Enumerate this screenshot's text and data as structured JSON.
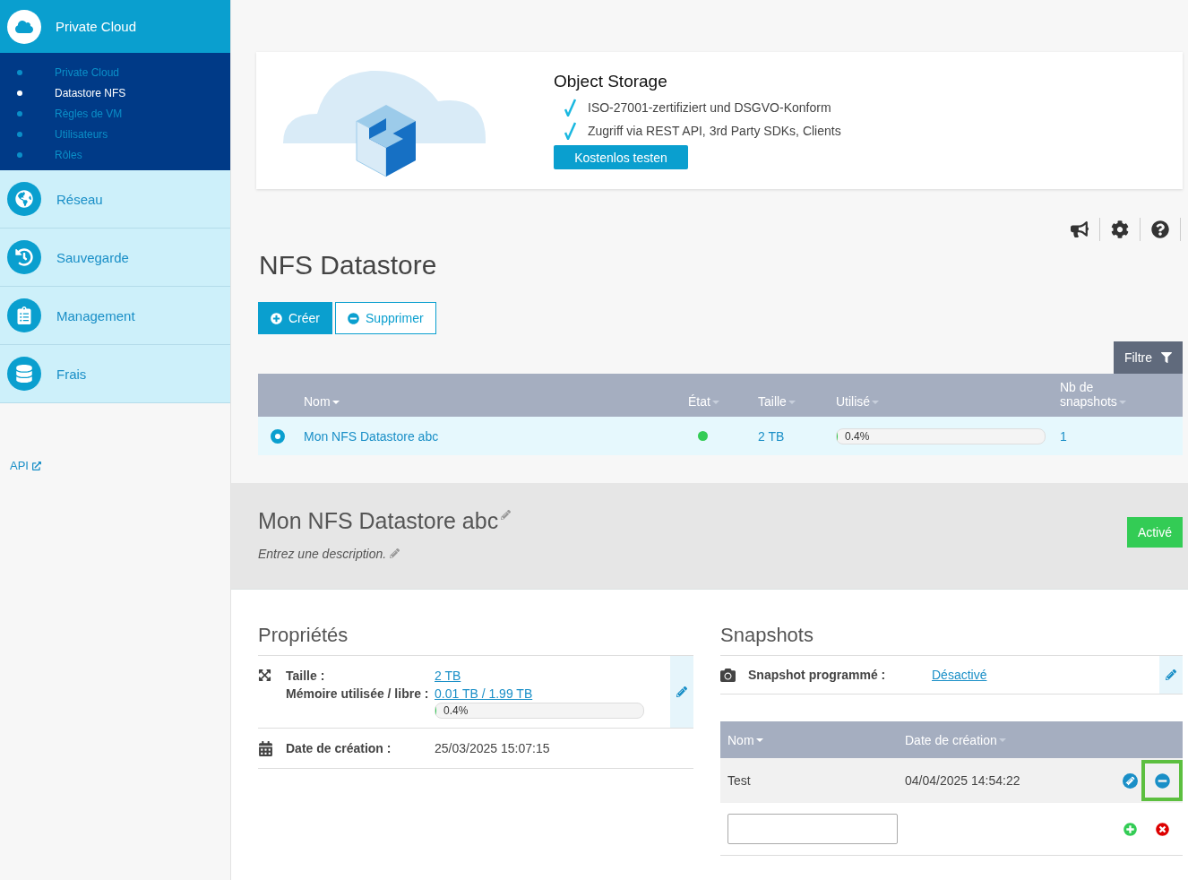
{
  "sidebar": {
    "header": {
      "label": "Private Cloud"
    },
    "subitems": [
      {
        "label": "Private Cloud",
        "selected": false
      },
      {
        "label": "Datastore NFS",
        "selected": true
      },
      {
        "label": "Règles de VM",
        "selected": false
      },
      {
        "label": "Utilisateurs",
        "selected": false
      },
      {
        "label": "Rôles",
        "selected": false
      }
    ],
    "sections": [
      {
        "label": "Réseau"
      },
      {
        "label": "Sauvegarde"
      },
      {
        "label": "Management"
      },
      {
        "label": "Frais"
      }
    ],
    "api_link": "API"
  },
  "banner": {
    "title": "Object Storage",
    "features": [
      "ISO-27001-zertifiziert und DSGVO-Konform",
      "Zugriff via REST API, 3rd Party SDKs, Clients"
    ],
    "button": "Kostenlos testen"
  },
  "page_title": "NFS Datastore",
  "actions": [
    {
      "label": "Créer",
      "kind": "create"
    },
    {
      "label": "Supprimer",
      "kind": "delete"
    }
  ],
  "filter_button": "Filtre",
  "table": {
    "columns": [
      "Nom",
      "État",
      "Taille",
      "Utilisé",
      "Nb de snapshots"
    ],
    "rows": [
      {
        "selected": true,
        "name": "Mon NFS Datastore abc",
        "active": true,
        "size": "2 TB",
        "level": 0.004,
        "reading": "0.4%",
        "snapshots": "1"
      }
    ]
  },
  "detail": {
    "title": "Mon NFS Datastore abc",
    "description": "Entrez une description.",
    "status": "Activé"
  },
  "properties": {
    "title": "Propriétés",
    "size_label": "Taille :",
    "size_value": "2 TB",
    "memory_label": "Mémoire utilisée / libre :",
    "memory_value": "0.01 TB / 1.99 TB",
    "level": 0.004,
    "reading": "0.4%",
    "created_label": "Date de création :",
    "created_value": "25/03/2025 15:07:15"
  },
  "snapshots": {
    "title": "Snapshots",
    "scheduled_label": "Snapshot programmé :",
    "scheduled_value": "Désactivé",
    "columns": [
      "Nom",
      "Date de création"
    ],
    "rows": [
      {
        "name": "Test",
        "date": "04/04/2025 14:54:22",
        "delete_highlighted": true
      }
    ]
  }
}
